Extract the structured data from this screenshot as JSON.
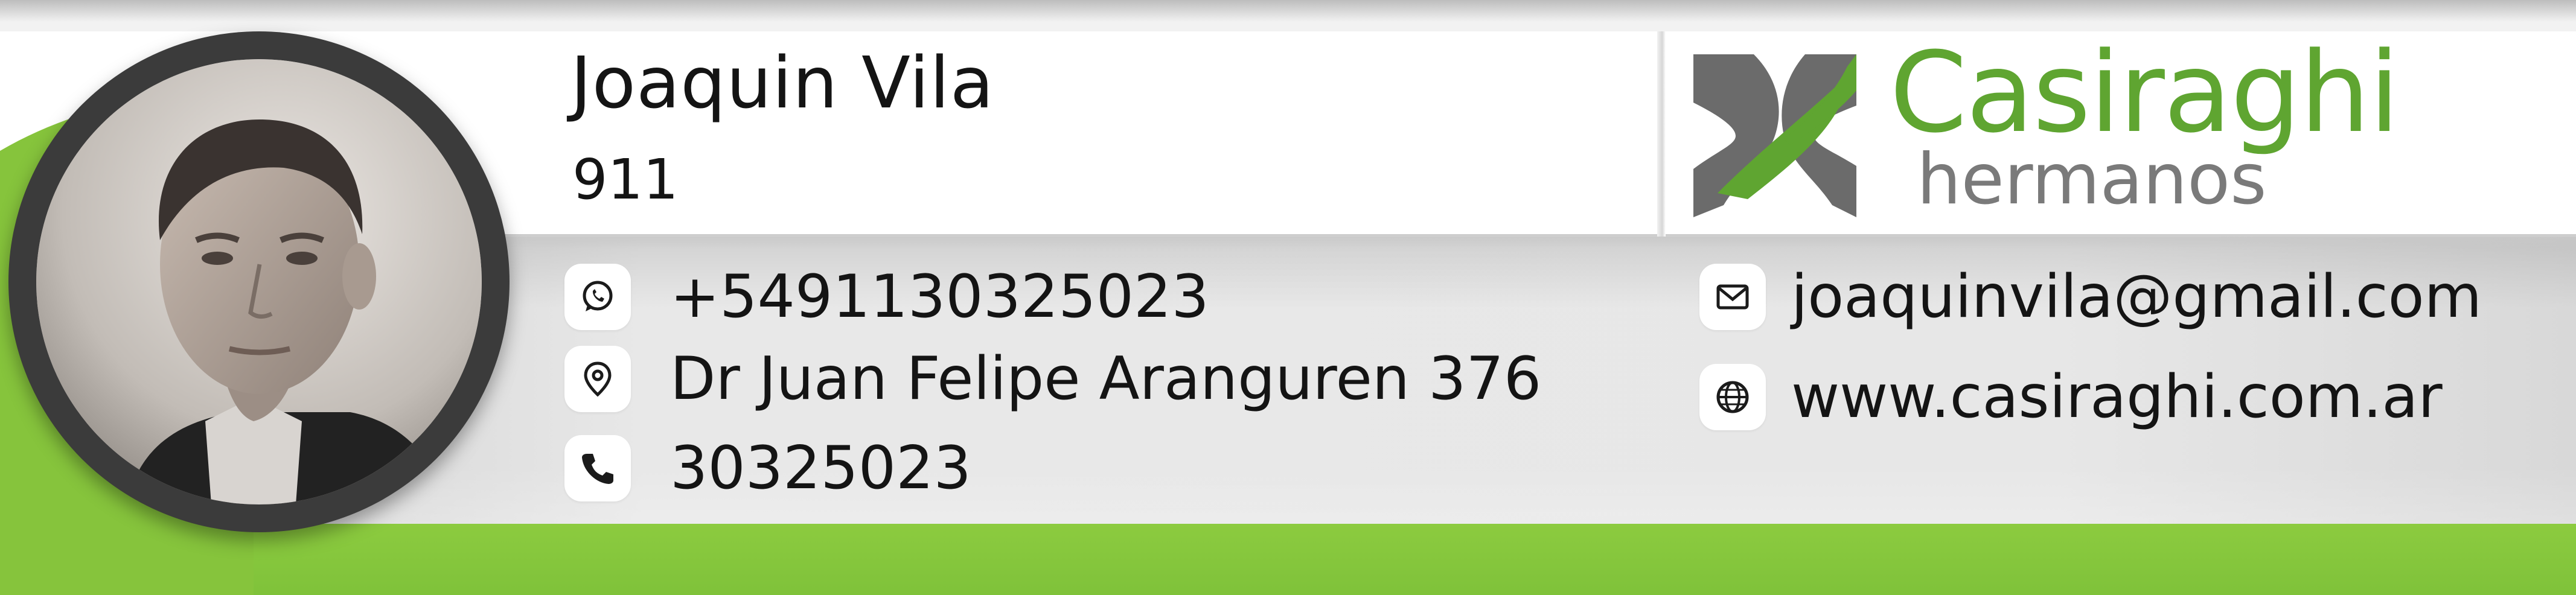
{
  "person": {
    "name": "Joaquin Vila",
    "extension": "911"
  },
  "company": {
    "name": "Casiraghi",
    "subtitle": "hermanos"
  },
  "contacts_left": [
    {
      "icon": "whatsapp-icon",
      "text": "+5491130325023"
    },
    {
      "icon": "location-pin-icon",
      "text": "Dr Juan Felipe Aranguren 376"
    },
    {
      "icon": "phone-icon",
      "text": "30325023"
    }
  ],
  "contacts_right": [
    {
      "icon": "envelope-icon",
      "text": "joaquinvila@gmail.com"
    },
    {
      "icon": "globe-icon",
      "text": "www.casiraghi.com.ar"
    }
  ],
  "colors": {
    "brand_green": "#5fa531",
    "bar_green": "#8ccb3f",
    "logo_grey": "#6b6b6b",
    "text": "#141414",
    "avatar_ring": "#3b3b3b"
  }
}
